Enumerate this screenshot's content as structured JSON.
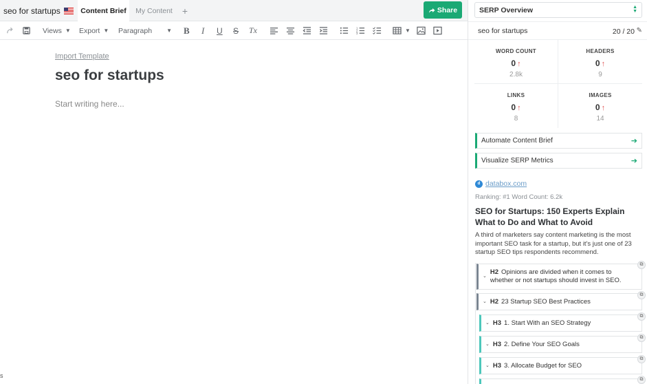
{
  "topbar": {
    "doc_title": "seo for startups",
    "flag_icon": "us-flag-icon",
    "settings_icon": "gear-icon",
    "tabs": [
      {
        "label": "Content Brief",
        "active": true
      },
      {
        "label": "My Content",
        "active": false
      }
    ],
    "add_tab_label": "+",
    "share_label": "Share",
    "accent_color": "#1aa974"
  },
  "toolbar": {
    "views_label": "Views",
    "export_label": "Export",
    "block_type_label": "Paragraph",
    "format": {
      "bold": "B",
      "italic": "I",
      "underline": "U",
      "strike": "S",
      "clear": "Tx"
    }
  },
  "editor": {
    "import_template_label": "Import Template",
    "heading": "seo for startups",
    "placeholder": "Start writing here...",
    "stray_char": "s"
  },
  "panel": {
    "mode_select_value": "SERP Overview",
    "keyword": "seo for startups",
    "keyword_count": "20 / 20",
    "metrics": [
      {
        "label": "WORD COUNT",
        "value": "0",
        "target": "2.8k"
      },
      {
        "label": "HEADERS",
        "value": "0",
        "target": "9"
      },
      {
        "label": "LINKS",
        "value": "0",
        "target": "8"
      },
      {
        "label": "IMAGES",
        "value": "0",
        "target": "14"
      }
    ],
    "actions": [
      {
        "label": "Automate Content Brief"
      },
      {
        "label": "Visualize SERP Metrics"
      }
    ],
    "result": {
      "domain": "databox.com",
      "badge": "d",
      "ranking_text": "Ranking: #1  Word Count: 6.2k",
      "title": "SEO for Startups: 150 Experts Explain What to Do and What to Avoid",
      "description": "A third of marketers say content marketing is the most important SEO task for a startup, but it's just one of 23 startup SEO tips respondents recommend.",
      "outline": [
        {
          "tag": "H2",
          "text": "Opinions are divided when it comes to whether or not startups should invest in SEO."
        },
        {
          "tag": "H2",
          "text": "23 Startup SEO Best Practices"
        },
        {
          "tag": "H3",
          "text": "1. Start With an SEO Strategy"
        },
        {
          "tag": "H3",
          "text": "2. Define Your SEO Goals"
        },
        {
          "tag": "H3",
          "text": "3. Allocate Budget for SEO"
        }
      ]
    },
    "up_color": "#e05353"
  }
}
